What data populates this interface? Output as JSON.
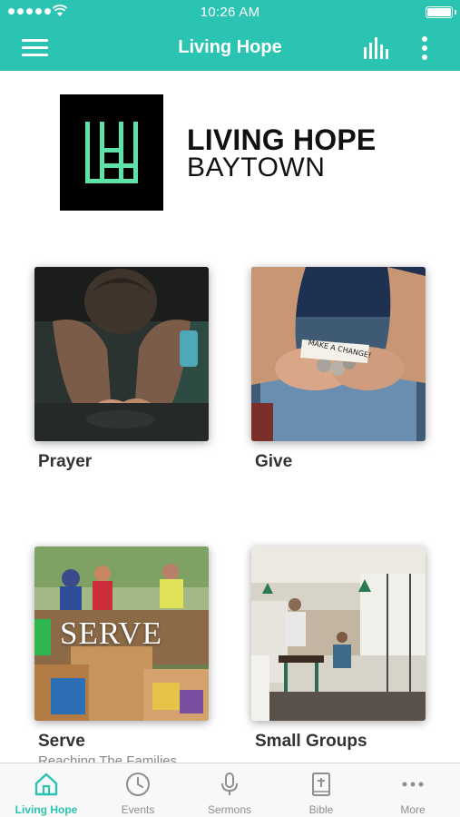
{
  "status_bar": {
    "time": "10:26 AM",
    "signal_icon": "signal-dots-icon",
    "wifi_icon": "wifi-icon",
    "battery_icon": "battery-icon",
    "battery_level": 1.0
  },
  "navbar": {
    "title": "Living Hope",
    "menu_icon": "hamburger-menu-icon",
    "audio_icon": "audio-bars-icon",
    "more_icon": "vertical-more-icon"
  },
  "logo": {
    "line1": "LIVING HOPE",
    "line2": "BAYTOWN"
  },
  "cards": [
    {
      "title": "Prayer",
      "subtitle": ""
    },
    {
      "title": "Give",
      "subtitle": "",
      "note_text": "MAKE A CHANGE!"
    },
    {
      "title": "Serve",
      "subtitle": "Reaching The Families",
      "overlay_text": "SERVE"
    },
    {
      "title": "Small Groups",
      "subtitle": ""
    }
  ],
  "tabs": [
    {
      "label": "Living Hope",
      "icon": "home-icon",
      "active": true
    },
    {
      "label": "Events",
      "icon": "clock-icon",
      "active": false
    },
    {
      "label": "Sermons",
      "icon": "microphone-icon",
      "active": false
    },
    {
      "label": "Bible",
      "icon": "bible-icon",
      "active": false
    },
    {
      "label": "More",
      "icon": "more-dots-icon",
      "active": false
    }
  ],
  "colors": {
    "accent": "#2bc3b1",
    "logo_green": "#5de3a8",
    "tab_inactive": "#8e8e93"
  }
}
